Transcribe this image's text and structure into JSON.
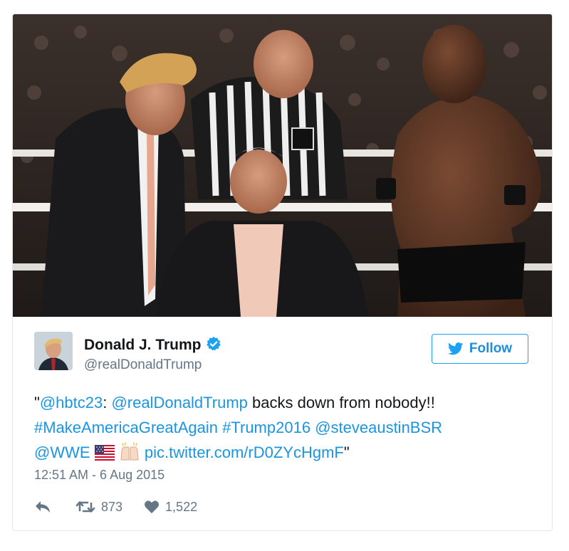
{
  "tweet": {
    "author": {
      "name": "Donald J. Trump",
      "handle": "@realDonaldTrump",
      "verified": true,
      "avatar_icon": "profile-photo"
    },
    "follow_label": "Follow",
    "text": {
      "quote_open": "\"",
      "mention_1": "@hbtc23",
      "colon": ": ",
      "mention_2": "@realDonaldTrump",
      "plain_1": " backs down from nobody!!",
      "hashtag_1": "#MakeAmericaGreatAgain",
      "hashtag_2": "#Trump2016",
      "mention_3": "@steveaustinBSR",
      "mention_4": "@WWE",
      "emoji_1": "us-flag",
      "emoji_2": "raised-hands",
      "link": "pic.twitter.com/rD0ZYcHgmF",
      "quote_close": "\""
    },
    "timestamp": "12:51 AM - 6 Aug 2015",
    "retweets": "873",
    "likes": "1,522",
    "colors": {
      "link": "#1b95e0",
      "follow": "#1da1f2",
      "muted": "#657786"
    }
  }
}
